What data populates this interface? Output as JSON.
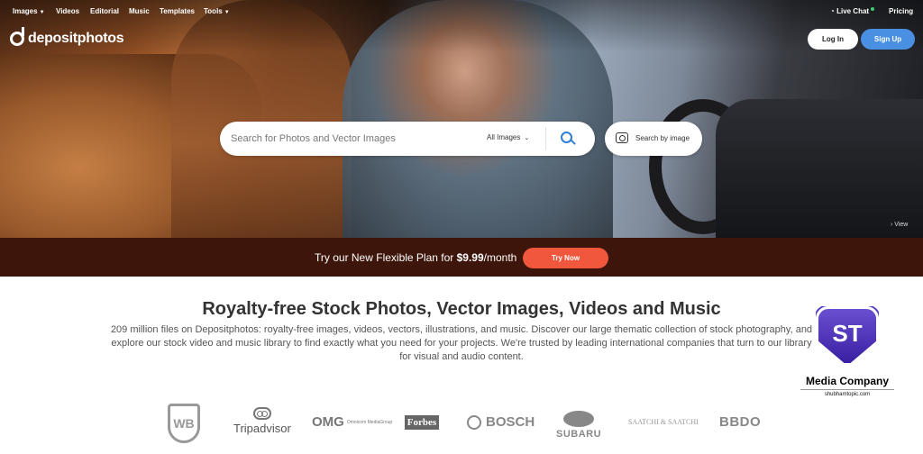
{
  "nav": {
    "items": [
      {
        "label": "Images",
        "dropdown": true
      },
      {
        "label": "Videos",
        "dropdown": false
      },
      {
        "label": "Editorial",
        "dropdown": false
      },
      {
        "label": "Music",
        "dropdown": false
      },
      {
        "label": "Templates",
        "dropdown": false
      },
      {
        "label": "Tools",
        "dropdown": true
      }
    ],
    "live_chat": "Live Chat",
    "pricing": "Pricing"
  },
  "brand": {
    "name": "depositphotos"
  },
  "auth": {
    "login": "Log In",
    "signup": "Sign Up"
  },
  "search": {
    "placeholder": "Search for Photos and Vector Images",
    "type_selected": "All Images",
    "by_image": "Search by image"
  },
  "hero": {
    "view_link": "View"
  },
  "promo": {
    "text_before": "Try our New Flexible Plan for ",
    "price": "$9.99",
    "text_after": "/month",
    "button": "Try Now"
  },
  "content": {
    "title": "Royalty-free Stock Photos, Vector Images, Videos and Music",
    "description": "209 million files on Depositphotos: royalty-free images, videos, vectors, illustrations, and music. Discover our large thematic collection of stock photography, and explore our stock video and music library to find exactly what you need for your projects. We're trusted by leading international companies that turn to our library for visual and audio content."
  },
  "client_logos": {
    "wb": "WB",
    "tripadvisor": "Tripadvisor",
    "omg": "OMG",
    "omg_sub": "Omnicom MediaGroup",
    "forbes": "Forbes",
    "bosch": "BOSCH",
    "subaru": "SUBARU",
    "saatchi": "SAATCHI & SAATCHI",
    "bbdo": "BBDO"
  },
  "watermark": {
    "mark": "ST",
    "name": "Media Company",
    "url": "shubhamtopic.com"
  },
  "colors": {
    "accent_blue": "#4a90e2",
    "promo_bg": "#3d150b",
    "try_button": "#f0573c"
  }
}
